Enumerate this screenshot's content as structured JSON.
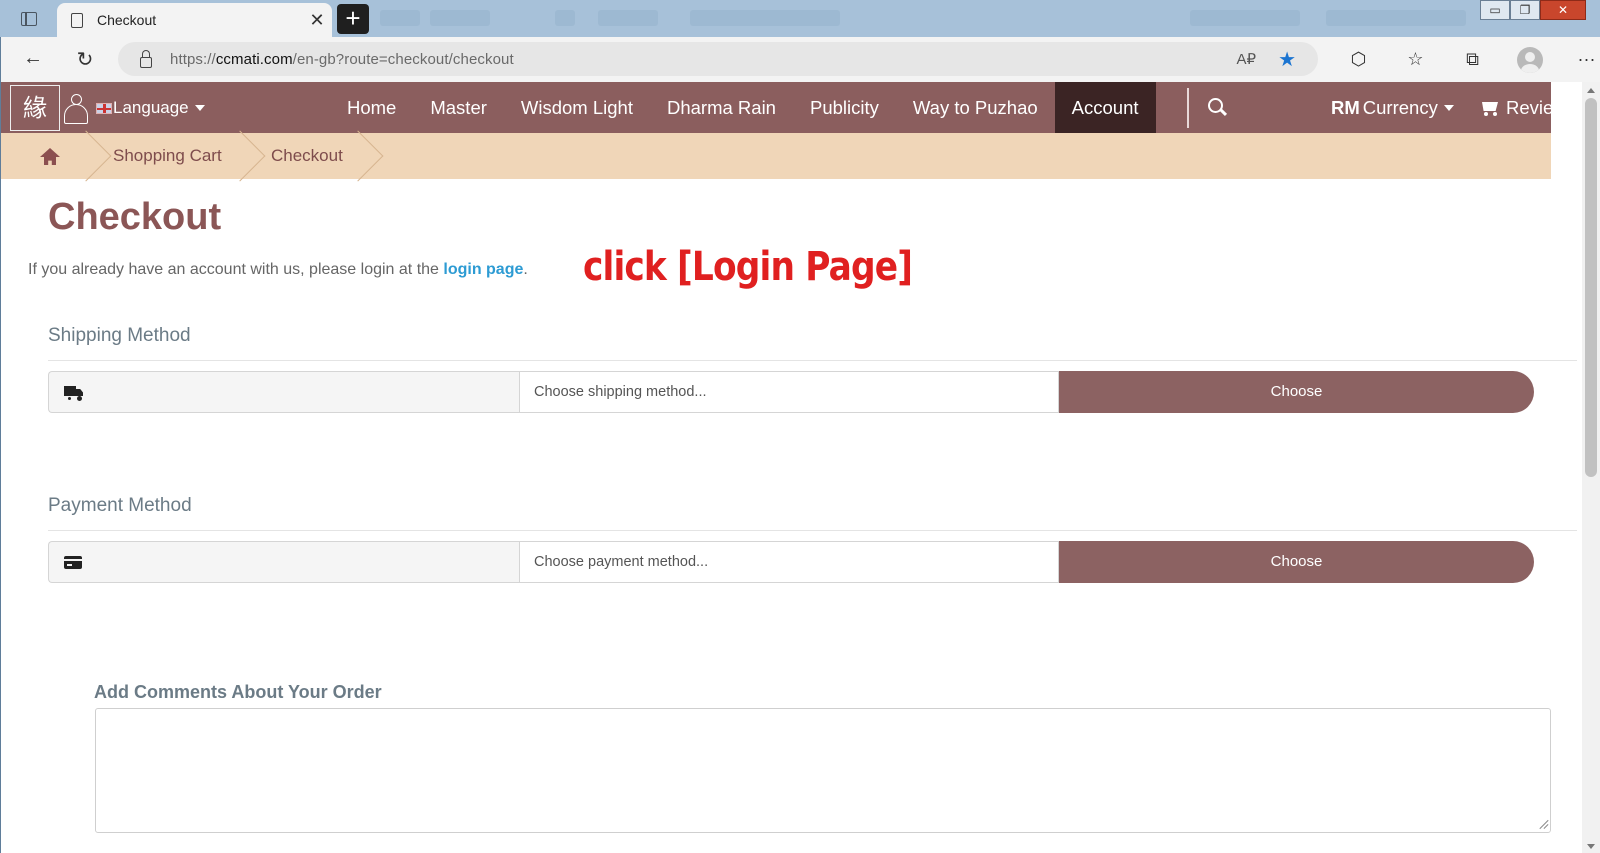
{
  "browser": {
    "tab_title": "Checkout",
    "tab_close_glyph": "✕",
    "new_tab_glyph": "+",
    "window_controls": [
      "▭",
      "❐",
      "✕"
    ],
    "url_prefix": "https://",
    "url_domain": "ccmati.com",
    "url_path": "/en-gb?route=checkout/checkout",
    "read_aloud_glyph": "A₽",
    "favorite_glyph": "★",
    "icons": [
      "back-icon",
      "refresh-icon",
      "lock-icon",
      "read-aloud-icon",
      "favorite-star-icon",
      "extensions-icon",
      "favorites-icon",
      "collections-icon",
      "profile-icon",
      "more-icon"
    ],
    "back_glyph": "←",
    "refresh_glyph": "↻",
    "extensions_glyph": "⬡",
    "favorites_glyph": "☆",
    "collections_glyph": "⧉",
    "more_glyph": "···"
  },
  "site": {
    "logo_glyph": "緣",
    "language_label": "Language",
    "menu": [
      "Home",
      "Master",
      "Wisdom Light",
      "Dharma Rain",
      "Publicity",
      "Way to Puzhao",
      "Account"
    ],
    "active_menu": "Account",
    "currency_symbol": "RM",
    "currency_label": "Currency",
    "review_label": "Review",
    "colors": {
      "nav_bg": "#8b5e5e",
      "active_bg": "#3b2424",
      "breadcrumb_bg": "#f0d6b8",
      "button_bg": "#8c6262",
      "link": "#2d9bd3",
      "annotation": "#e02020"
    }
  },
  "breadcrumb": [
    "Shopping Cart",
    "Checkout"
  ],
  "main": {
    "title": "Checkout",
    "login_prefix": "If you already have an account with us, please login at the ",
    "login_link": "login page",
    "login_suffix": ".",
    "annotation": "click [Login Page]",
    "shipping": {
      "heading": "Shipping Method",
      "placeholder": "Choose shipping method...",
      "button": "Choose"
    },
    "payment": {
      "heading": "Payment Method",
      "placeholder": "Choose payment method...",
      "button": "Choose"
    },
    "comments": {
      "label": "Add Comments About Your Order",
      "value": ""
    }
  }
}
